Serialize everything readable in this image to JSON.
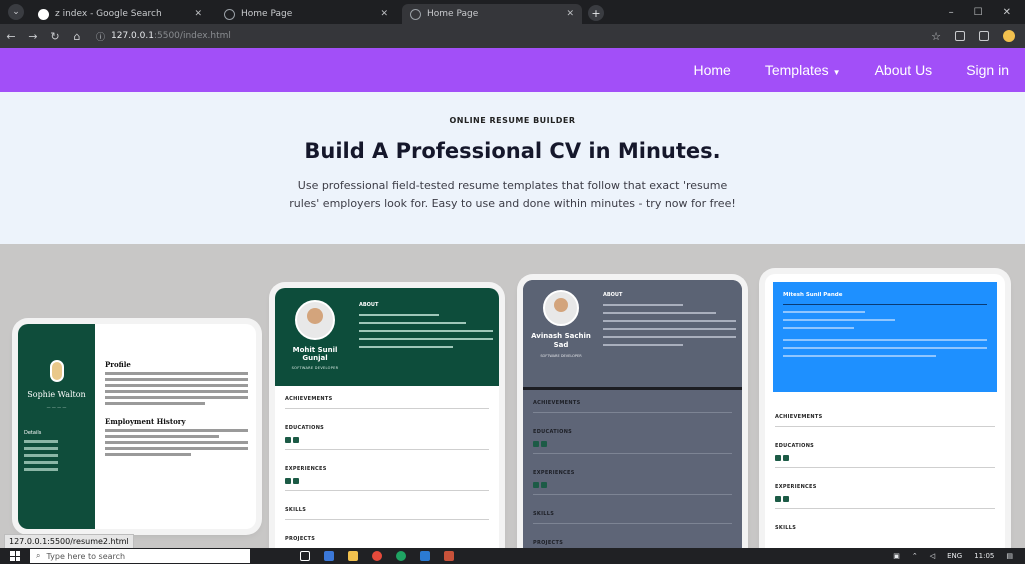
{
  "browser": {
    "tabs": [
      {
        "title": "z index - Google Search",
        "active": false
      },
      {
        "title": "Home Page",
        "active": false
      },
      {
        "title": "Home Page",
        "active": true
      }
    ],
    "address_host": "127.0.0.1",
    "address_path": ":5500/index.html",
    "status_url": "127.0.0.1:5500/resume2.html"
  },
  "nav": {
    "home": "Home",
    "templates": "Templates",
    "about": "About Us",
    "signin": "Sign in"
  },
  "hero": {
    "eyebrow": "ONLINE RESUME BUILDER",
    "title": "Build A Professional CV in Minutes.",
    "line1": "Use professional field-tested resume templates that follow that exact 'resume",
    "line2": "rules' employers look for. Easy to use and done within minutes - try now for free!"
  },
  "templates": {
    "card1": {
      "name": "Sophie Walton",
      "profile": "Profile",
      "details": "Details",
      "employment": "Employment History"
    },
    "card2": {
      "name_line1": "Mohit Sunil",
      "name_line2": "Gunjal",
      "role": "SOFTWARE DEVELOPER",
      "about": "ABOUT",
      "sections": [
        "ACHIEVEMENTS",
        "EDUCATIONS",
        "EXPERIENCES",
        "SKILLS",
        "PROJECTS"
      ]
    },
    "card3": {
      "name_line1": "Avinash Sachin",
      "name_line2": "Sad",
      "role": "SOFTWARE DEVELOPER",
      "about": "ABOUT",
      "sections": [
        "ACHIEVEMENTS",
        "EDUCATIONS",
        "EXPERIENCES",
        "SKILLS",
        "PROJECTS"
      ]
    },
    "card4": {
      "name": "Mitesh Sunil Pande",
      "sections": [
        "ACHIEVEMENTS",
        "EDUCATIONS",
        "EXPERIENCES",
        "SKILLS"
      ]
    }
  },
  "taskbar": {
    "search_placeholder": "Type here to search",
    "time": "11:05",
    "lang": "ENG"
  },
  "colors": {
    "nav_purple": "#a24ff8",
    "green_dark": "#0d4d3b",
    "slate": "#5e6577",
    "blue": "#1e90ff"
  }
}
